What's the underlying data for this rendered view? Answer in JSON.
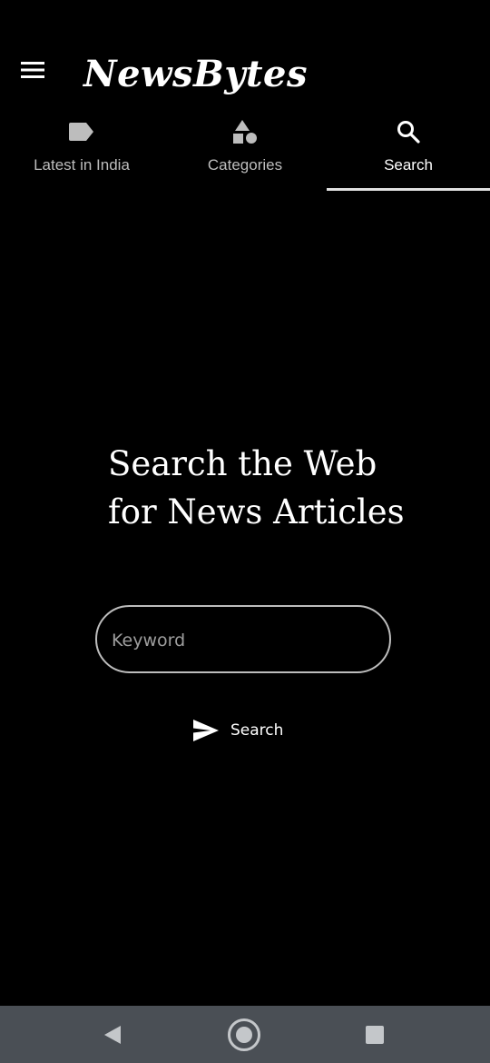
{
  "app_bar": {
    "title": "NewsBytes",
    "menu_icon": "hamburger-menu-icon"
  },
  "tabs": [
    {
      "label": "Latest in India",
      "icon": "label-tag-icon",
      "active": false
    },
    {
      "label": "Categories",
      "icon": "shapes-icon",
      "active": false
    },
    {
      "label": "Search",
      "icon": "search-icon",
      "active": true
    }
  ],
  "main": {
    "headline_line1": "Search the Web",
    "headline_line2": "for News Articles",
    "keyword_placeholder": "Keyword",
    "keyword_value": "",
    "search_button_label": "Search",
    "search_button_icon": "send-icon"
  },
  "nav_bar": {
    "back_icon": "back-triangle-icon",
    "home_icon": "home-circle-icon",
    "recents_icon": "recents-square-icon"
  },
  "colors": {
    "background": "#000000",
    "text": "#ffffff",
    "inactive_tab_text": "#bdbdbd",
    "field_border": "#bdbdbd",
    "nav_bar": "#4a4f55"
  }
}
